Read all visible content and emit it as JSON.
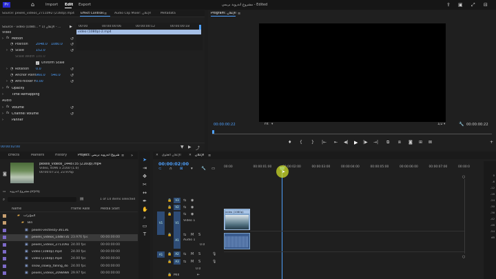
{
  "menu": {
    "import": "Import",
    "edit": "Edit",
    "export": "Export",
    "title": "مشروع أندرويد بريمي - Edited"
  },
  "source": {
    "tab_source": "Source: pexels_videos_2711092 (2160p).mp4",
    "tab_effects": "Effect Controls",
    "tab_mixer": "Audio Clip Mixer: الإعلان",
    "tab_meta": "Metadata",
    "clip_path": "Source - video (1080... * الإعلان (1 - ...",
    "timecodes": [
      "00:00",
      "00:00:00:06",
      "00:00:00:12",
      "00:00:00:18"
    ],
    "clip_name": "video (1080p)-2.mp4",
    "sections": {
      "video": "Video",
      "audio": "Audio"
    },
    "props": [
      {
        "name": "Motion",
        "fx": true
      },
      {
        "name": "Position",
        "v1": "2048.0",
        "v2": "1080.0"
      },
      {
        "name": "Scale",
        "v1": "152.0"
      },
      {
        "name": "Scale Width",
        "v1": "100.0"
      },
      {
        "name": "Uniform Scale"
      },
      {
        "name": "Rotation",
        "v1": "0.0"
      },
      {
        "name": "Anchor Point",
        "v1": "960.0",
        "v2": "540.0"
      },
      {
        "name": "Anti-flicker F...",
        "v1": "0.00"
      },
      {
        "name": "Opacity",
        "fx": true
      },
      {
        "name": "Time Remapping"
      },
      {
        "name": "Volume",
        "fx": true
      },
      {
        "name": "Channel Volume",
        "fx": true
      },
      {
        "name": "Panner"
      }
    ],
    "bottom_tc": "00:00:02:00"
  },
  "program": {
    "tab": "Program: الإعلان",
    "tc_left": "00:00:00:22",
    "fit": "Fit",
    "ratio": "1/2",
    "tc_right": "00:00:00:22"
  },
  "project": {
    "tabs": [
      "Effects",
      "Markers",
      "History",
      "Project: مشروع أندرويد بريمي"
    ],
    "thumb_name": "pexels_videos_1448735 (2160p).mp4",
    "thumb_info": "Video, 4096 x 2160 (1.0)",
    "thumb_dur": "00:00:07:23, 23.976p",
    "prproj": "مشروع أندرويد.prproj",
    "count": "1 of 14 items selected",
    "cols": [
      "Name",
      "Frame Rate",
      "Media Start"
    ],
    "items": [
      {
        "name": "المؤثرات",
        "fps": "",
        "start": "",
        "folder": true
      },
      {
        "name": "Bin",
        "fps": "",
        "start": "",
        "folder": true
      },
      {
        "name": "pexels-vecteezy-36136...",
        "fps": "",
        "start": ""
      },
      {
        "name": "pexels_videos_1448735",
        "fps": "23.976 fps",
        "start": "00:00:00:00",
        "sel": true
      },
      {
        "name": "pexels_videos_2711092",
        "fps": "24.00 fps",
        "start": "00:00:00:00"
      },
      {
        "name": "video (1080p).mp4",
        "fps": "24.00 fps",
        "start": "00:00:00:00"
      },
      {
        "name": "video (2160p).mp4",
        "fps": "24.00 fps",
        "start": "00:00:00:00"
      },
      {
        "name": "snow_slowly_falling_do",
        "fps": "24.00 fps",
        "start": "00:00:00:00"
      },
      {
        "name": "pexels_videos_2098989",
        "fps": "29.97 fps",
        "start": "00:00:00:00"
      }
    ]
  },
  "timeline": {
    "tabs": [
      "الإعلان العلوي",
      "الإعلان"
    ],
    "tc": "00:00:02:00",
    "ruler": [
      "00:00",
      "00:00:01:00",
      "00:00:02:00",
      "00:00:03:00",
      "00:00:04:00",
      "00:00:05:00",
      "00:00:06:00",
      "00:00:07:00",
      "00:00:0"
    ],
    "tracks_v": [
      "V3",
      "V2",
      "V1"
    ],
    "tracks_a": [
      "A1",
      "A2",
      "A3"
    ],
    "v1_name": "Video 1",
    "a1_name": "Audio 1",
    "mix": "Mix",
    "mix_val": "0.0",
    "a_val": "0.0",
    "clip_label": "video (1080p)",
    "db": [
      "0",
      "-6",
      "-12",
      "-18",
      "-24",
      "-30",
      "-36",
      "-42",
      "-48",
      "-54",
      "dB"
    ]
  }
}
